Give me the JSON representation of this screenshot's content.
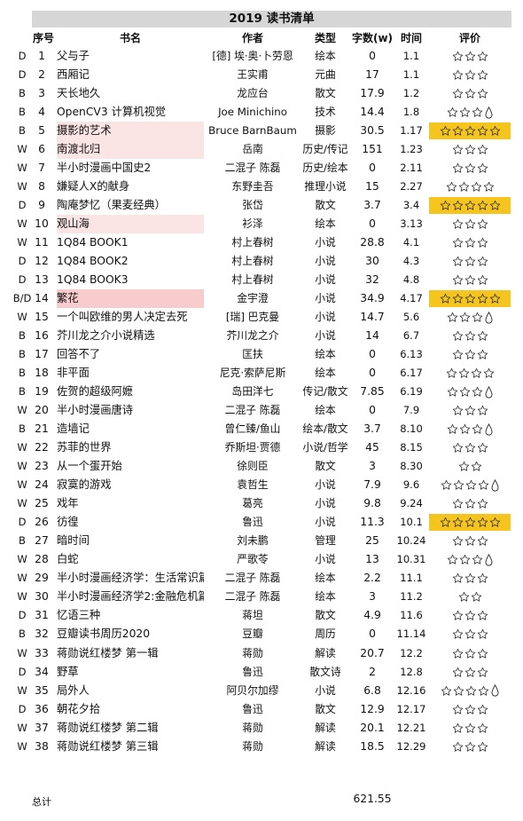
{
  "title": "2019 读书清单",
  "headers": {
    "no": "序号",
    "title": "书名",
    "author": "作者",
    "genre": "类型",
    "words": "字数(w)",
    "time": "时间",
    "rating": "评价"
  },
  "highlight_colors": {
    "light": "#fbe4e4",
    "strong": "#f8cccc",
    "gold": "#f6c51d"
  },
  "rows": [
    {
      "type": "D",
      "no": "1",
      "title": "父与子",
      "author": "[德] 埃·奥·卜劳恩",
      "genre": "绘本",
      "words": "0",
      "time": "1.1",
      "stars": 3,
      "half": false,
      "gold": false,
      "hl": ""
    },
    {
      "type": "D",
      "no": "2",
      "title": "西厢记",
      "author": "王实甫",
      "genre": "元曲",
      "words": "17",
      "time": "1.1",
      "stars": 3,
      "half": false,
      "gold": false,
      "hl": ""
    },
    {
      "type": "B",
      "no": "3",
      "title": "天长地久",
      "author": "龙应台",
      "genre": "散文",
      "words": "17.9",
      "time": "1.2",
      "stars": 3,
      "half": false,
      "gold": false,
      "hl": ""
    },
    {
      "type": "B",
      "no": "4",
      "title": "OpenCV3 计算机视觉",
      "author": "Joe Minichino",
      "genre": "技术",
      "words": "14.4",
      "time": "1.8",
      "stars": 3,
      "half": true,
      "gold": false,
      "hl": ""
    },
    {
      "type": "B",
      "no": "5",
      "title": "摄影的艺术",
      "author": "Bruce BarnBaum",
      "genre": "摄影",
      "words": "30.5",
      "time": "1.17",
      "stars": 5,
      "half": false,
      "gold": true,
      "hl": "light"
    },
    {
      "type": "W",
      "no": "6",
      "title": "南渡北归",
      "author": "岳南",
      "genre": "历史/传记",
      "words": "151",
      "time": "1.23",
      "stars": 3,
      "half": false,
      "gold": false,
      "hl": "light"
    },
    {
      "type": "W",
      "no": "7",
      "title": "半小时漫画中国史2",
      "author": "二混子 陈磊",
      "genre": "历史/绘本",
      "words": "0",
      "time": "2.11",
      "stars": 3,
      "half": false,
      "gold": false,
      "hl": ""
    },
    {
      "type": "W",
      "no": "8",
      "title": "嫌疑人X的献身",
      "author": "东野圭吾",
      "genre": "推理小说",
      "words": "15",
      "time": "2.27",
      "stars": 4,
      "half": false,
      "gold": false,
      "hl": ""
    },
    {
      "type": "D",
      "no": "9",
      "title": "陶庵梦忆（果麦经典）",
      "author": "张岱",
      "genre": "散文",
      "words": "3.7",
      "time": "3.4",
      "stars": 5,
      "half": false,
      "gold": true,
      "hl": ""
    },
    {
      "type": "W",
      "no": "10",
      "title": "观山海",
      "author": "衫泽",
      "genre": "绘本",
      "words": "0",
      "time": "3.13",
      "stars": 3,
      "half": false,
      "gold": false,
      "hl": "light"
    },
    {
      "type": "W",
      "no": "11",
      "title": "1Q84 BOOK1",
      "author": "村上春树",
      "genre": "小说",
      "words": "28.8",
      "time": "4.1",
      "stars": 3,
      "half": false,
      "gold": false,
      "hl": ""
    },
    {
      "type": "D",
      "no": "12",
      "title": "1Q84 BOOK2",
      "author": "村上春树",
      "genre": "小说",
      "words": "30",
      "time": "4.3",
      "stars": 3,
      "half": false,
      "gold": false,
      "hl": ""
    },
    {
      "type": "D",
      "no": "13",
      "title": "1Q84 BOOK3",
      "author": "村上春树",
      "genre": "小说",
      "words": "32",
      "time": "4.8",
      "stars": 3,
      "half": false,
      "gold": false,
      "hl": ""
    },
    {
      "type": "B/D",
      "no": "14",
      "title": "繁花",
      "author": "金宇澄",
      "genre": "小说",
      "words": "34.9",
      "time": "4.17",
      "stars": 5,
      "half": false,
      "gold": true,
      "hl": "strong"
    },
    {
      "type": "W",
      "no": "15",
      "title": "一个叫欧维的男人决定去死",
      "author": "[瑞] 巴克曼",
      "genre": "小说",
      "words": "14.7",
      "time": "5.6",
      "stars": 3,
      "half": true,
      "gold": false,
      "hl": ""
    },
    {
      "type": "B",
      "no": "16",
      "title": "芥川龙之介小说精选",
      "author": "芥川龙之介",
      "genre": "小说",
      "words": "14",
      "time": "6.7",
      "stars": 3,
      "half": false,
      "gold": false,
      "hl": ""
    },
    {
      "type": "B",
      "no": "17",
      "title": "回答不了",
      "author": "匡扶",
      "genre": "绘本",
      "words": "0",
      "time": "6.13",
      "stars": 3,
      "half": false,
      "gold": false,
      "hl": ""
    },
    {
      "type": "B",
      "no": "18",
      "title": "非平面",
      "author": "尼克·索萨尼斯",
      "genre": "绘本",
      "words": "0",
      "time": "6.17",
      "stars": 4,
      "half": false,
      "gold": false,
      "hl": ""
    },
    {
      "type": "B",
      "no": "19",
      "title": "佐贺的超级阿嬷",
      "author": "岛田洋七",
      "genre": "传记/散文",
      "words": "7.85",
      "time": "6.19",
      "stars": 3,
      "half": true,
      "gold": false,
      "hl": ""
    },
    {
      "type": "W",
      "no": "20",
      "title": "半小时漫画唐诗",
      "author": "二混子 陈磊",
      "genre": "绘本",
      "words": "0",
      "time": "7.9",
      "stars": 3,
      "half": false,
      "gold": false,
      "hl": ""
    },
    {
      "type": "B",
      "no": "21",
      "title": "造墙记",
      "author": "曾仁臻/鱼山",
      "genre": "绘本/散文",
      "words": "3.7",
      "time": "8.10",
      "stars": 3,
      "half": true,
      "gold": false,
      "hl": ""
    },
    {
      "type": "W",
      "no": "22",
      "title": "苏菲的世界",
      "author": "乔斯坦·贾德",
      "genre": "小说/哲学",
      "words": "45",
      "time": "8.15",
      "stars": 3,
      "half": false,
      "gold": false,
      "hl": ""
    },
    {
      "type": "W",
      "no": "23",
      "title": "从一个蛋开始",
      "author": "徐则臣",
      "genre": "散文",
      "words": "3",
      "time": "8.30",
      "stars": 2,
      "half": false,
      "gold": false,
      "hl": ""
    },
    {
      "type": "W",
      "no": "24",
      "title": "寂寞的游戏",
      "author": "袁哲生",
      "genre": "小说",
      "words": "7.9",
      "time": "9.6",
      "stars": 4,
      "half": true,
      "gold": false,
      "hl": ""
    },
    {
      "type": "W",
      "no": "25",
      "title": "戏年",
      "author": "葛亮",
      "genre": "小说",
      "words": "9.8",
      "time": "9.24",
      "stars": 3,
      "half": false,
      "gold": false,
      "hl": ""
    },
    {
      "type": "D",
      "no": "26",
      "title": "彷徨",
      "author": "鲁迅",
      "genre": "小说",
      "words": "11.3",
      "time": "10.1",
      "stars": 5,
      "half": false,
      "gold": true,
      "hl": ""
    },
    {
      "type": "B",
      "no": "27",
      "title": "暗时间",
      "author": "刘未鹏",
      "genre": "管理",
      "words": "25",
      "time": "10.24",
      "stars": 3,
      "half": false,
      "gold": false,
      "hl": ""
    },
    {
      "type": "W",
      "no": "28",
      "title": "白蛇",
      "author": "严歌苓",
      "genre": "小说",
      "words": "13",
      "time": "10.31",
      "stars": 3,
      "half": true,
      "gold": false,
      "hl": ""
    },
    {
      "type": "W",
      "no": "29",
      "title": "半小时漫画经济学：生活常识篇",
      "author": "二混子 陈磊",
      "genre": "绘本",
      "words": "2.2",
      "time": "11.1",
      "stars": 3,
      "half": false,
      "gold": false,
      "hl": ""
    },
    {
      "type": "W",
      "no": "30",
      "title": "半小时漫画经济学2:金融危机篇",
      "author": "二混子 陈磊",
      "genre": "绘本",
      "words": "3",
      "time": "11.2",
      "stars": 2,
      "half": false,
      "gold": false,
      "hl": ""
    },
    {
      "type": "D",
      "no": "31",
      "title": "忆语三种",
      "author": "蒋坦",
      "genre": "散文",
      "words": "4.9",
      "time": "11.6",
      "stars": 3,
      "half": false,
      "gold": false,
      "hl": ""
    },
    {
      "type": "B",
      "no": "32",
      "title": "豆瓣读书周历2020",
      "author": "豆瓣",
      "genre": "周历",
      "words": "0",
      "time": "11.14",
      "stars": 3,
      "half": false,
      "gold": false,
      "hl": ""
    },
    {
      "type": "W",
      "no": "33",
      "title": "蒋勋说红楼梦 第一辑",
      "author": "蒋勋",
      "genre": "解读",
      "words": "20.7",
      "time": "12.2",
      "stars": 3,
      "half": false,
      "gold": false,
      "hl": ""
    },
    {
      "type": "D",
      "no": "34",
      "title": "野草",
      "author": "鲁迅",
      "genre": "散文诗",
      "words": "2",
      "time": "12.8",
      "stars": 3,
      "half": false,
      "gold": false,
      "hl": ""
    },
    {
      "type": "W",
      "no": "35",
      "title": "局外人",
      "author": "阿贝尔加缪",
      "genre": "小说",
      "words": "6.8",
      "time": "12.16",
      "stars": 4,
      "half": true,
      "gold": false,
      "hl": ""
    },
    {
      "type": "D",
      "no": "36",
      "title": "朝花夕拾",
      "author": "鲁迅",
      "genre": "散文",
      "words": "12.9",
      "time": "12.17",
      "stars": 3,
      "half": false,
      "gold": false,
      "hl": ""
    },
    {
      "type": "W",
      "no": "37",
      "title": "蒋勋说红楼梦 第二辑",
      "author": "蒋勋",
      "genre": "解读",
      "words": "20.1",
      "time": "12.21",
      "stars": 3,
      "half": false,
      "gold": false,
      "hl": ""
    },
    {
      "type": "W",
      "no": "38",
      "title": "蒋勋说红楼梦 第三辑",
      "author": "蒋勋",
      "genre": "解读",
      "words": "18.5",
      "time": "12.29",
      "stars": 3,
      "half": false,
      "gold": false,
      "hl": ""
    }
  ],
  "total": {
    "label": "总计",
    "value": "621.55"
  }
}
